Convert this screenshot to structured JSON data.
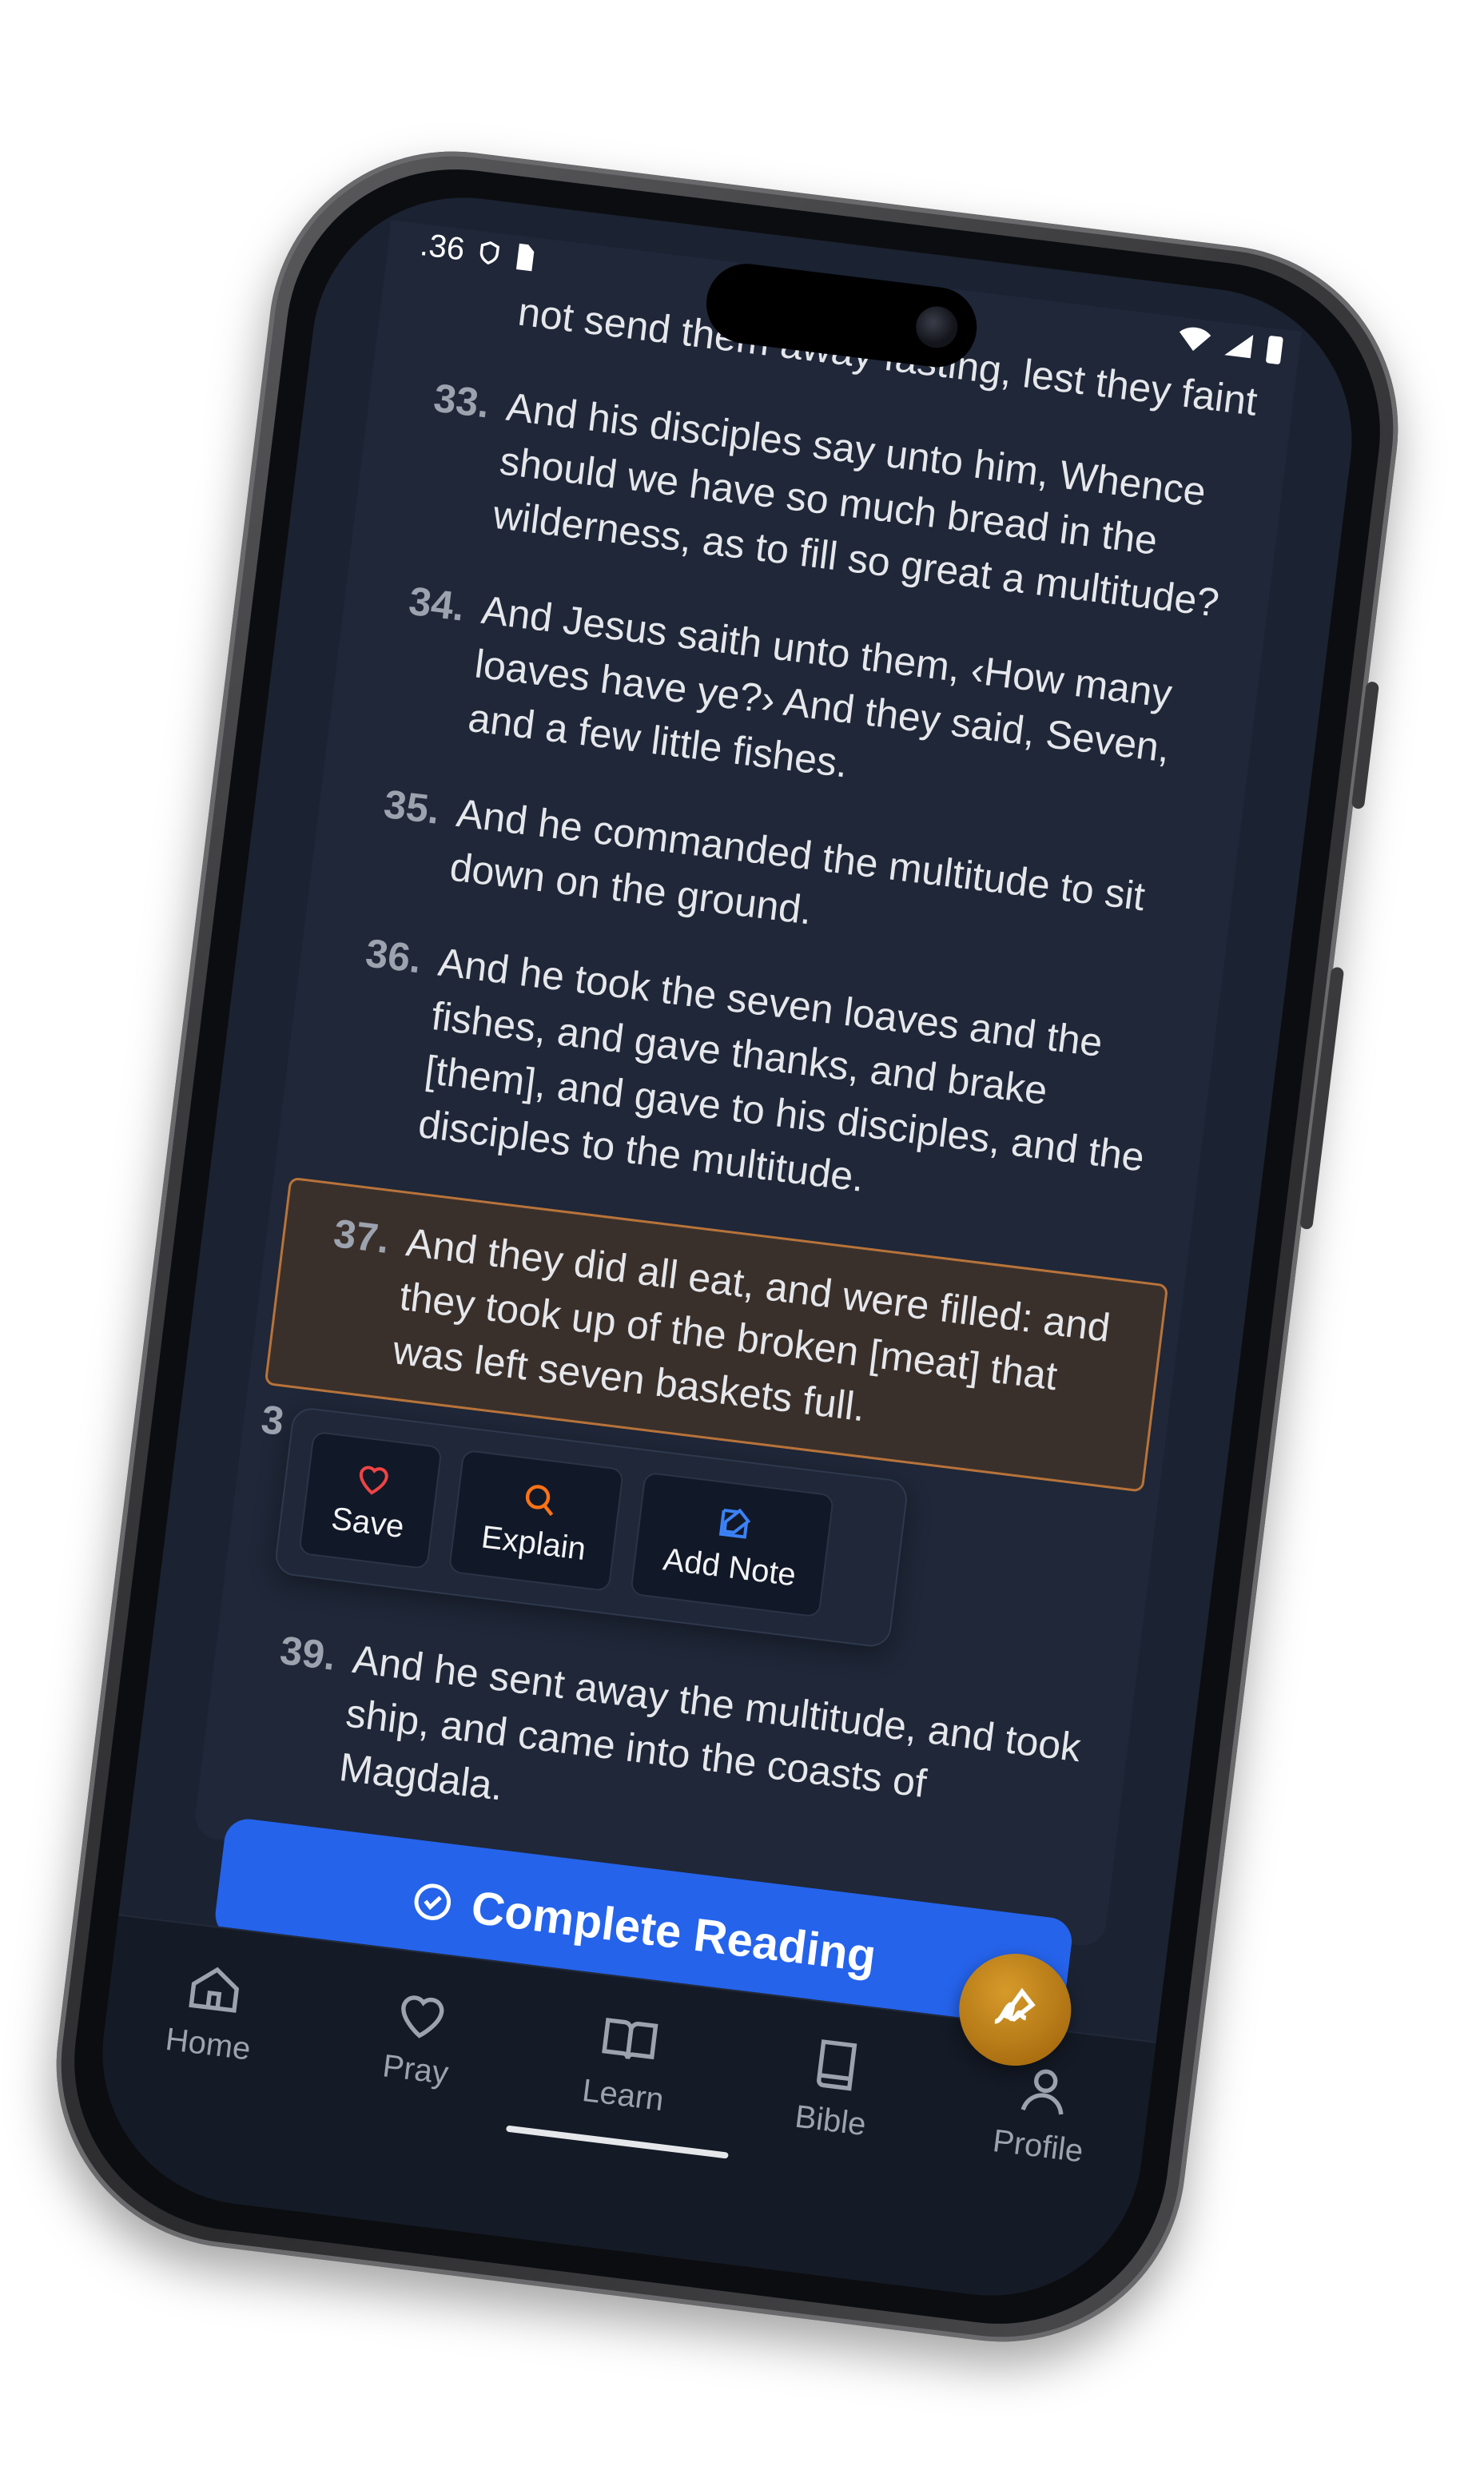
{
  "status": {
    "time_fragment": ".36"
  },
  "verses": [
    {
      "num": "",
      "text": "not send them away fasting, lest they faint"
    },
    {
      "num": "33.",
      "text": "And his disciples say unto him, Whence should we have so much bread in the wilderness, as to fill so great a multitude?"
    },
    {
      "num": "34.",
      "text": "And Jesus saith unto them, ‹How many loaves have ye?› And they said, Seven, and a few little fishes."
    },
    {
      "num": "35.",
      "text": "And he commanded the multitude to sit down on the ground."
    },
    {
      "num": "36.",
      "text": "And he took the seven loaves and the fishes, and gave thanks, and brake [them], and gave to his disciples, and the disciples to the multitude."
    },
    {
      "num": "37.",
      "text": "And they did all eat, and were filled: and they took up of the broken [meat] that was left seven baskets full."
    },
    {
      "num": "39.",
      "text": "And he sent away the multitude, and took ship, and came into the coasts of Magdala."
    }
  ],
  "hidden_verse_num": "3",
  "popup": {
    "save": "Save",
    "explain": "Explain",
    "add_note": "Add Note"
  },
  "cta": {
    "label": "Complete Reading"
  },
  "tabs": [
    {
      "label": "Home",
      "icon": "home-icon"
    },
    {
      "label": "Pray",
      "icon": "heart-icon"
    },
    {
      "label": "Learn",
      "icon": "book-open-icon"
    },
    {
      "label": "Bible",
      "icon": "bible-icon"
    },
    {
      "label": "Profile",
      "icon": "user-icon"
    }
  ],
  "colors": {
    "accent": "#2563eb",
    "highlight_border": "#b8733a",
    "fab": "#c0851a",
    "background": "#1b2232"
  }
}
